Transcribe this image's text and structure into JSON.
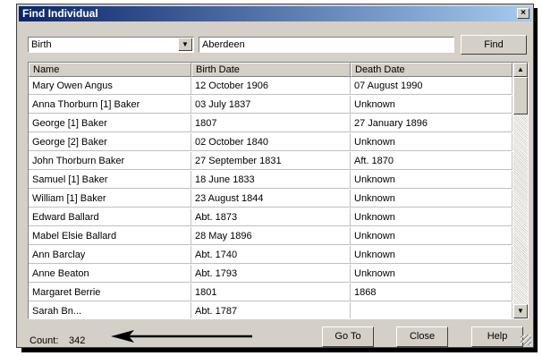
{
  "window": {
    "title": "Find Individual",
    "close_glyph": "×"
  },
  "search": {
    "field_value": "Birth",
    "query_value": "Aberdeen",
    "find_label": "Find"
  },
  "table": {
    "headers": [
      "Name",
      "Birth Date",
      "Death Date"
    ],
    "rows": [
      [
        "Mary Owen Angus",
        "12 October 1906",
        "07 August 1990"
      ],
      [
        "Anna Thorburn [1] Baker",
        "03 July 1837",
        "Unknown"
      ],
      [
        "George [1] Baker",
        "1807",
        "27 January 1896"
      ],
      [
        "George [2] Baker",
        "02 October 1840",
        "Unknown"
      ],
      [
        "John Thorburn Baker",
        "27 September 1831",
        "Aft. 1870"
      ],
      [
        "Samuel [1] Baker",
        "18 June 1833",
        "Unknown"
      ],
      [
        "William [1] Baker",
        "23 August 1844",
        "Unknown"
      ],
      [
        "Edward Ballard",
        "Abt. 1873",
        "Unknown"
      ],
      [
        "Mabel Elsie Ballard",
        "28 May 1896",
        "Unknown"
      ],
      [
        "Ann Barclay",
        "Abt. 1740",
        "Unknown"
      ],
      [
        "Anne Beaton",
        "Abt. 1793",
        "Unknown"
      ],
      [
        "Margaret Berrie",
        "1801",
        "1868"
      ],
      [
        "Sarah Bn...",
        "Abt. 1787",
        ""
      ]
    ]
  },
  "footer": {
    "count_label": "Count:",
    "count_value": "342",
    "goto_label": "Go To",
    "close_label": "Close",
    "help_label": "Help"
  }
}
